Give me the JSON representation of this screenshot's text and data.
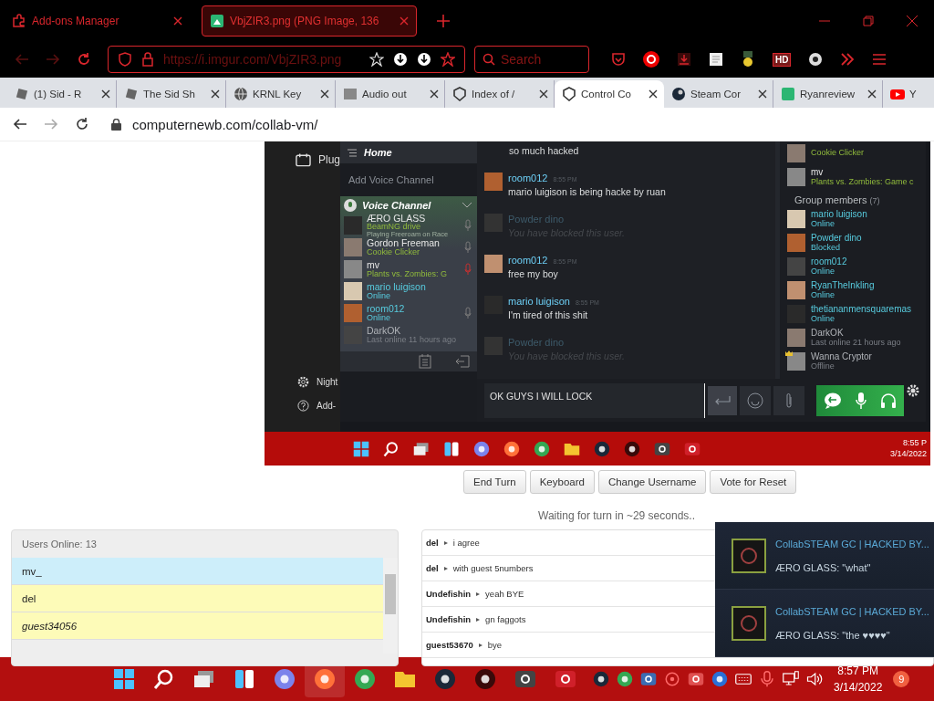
{
  "firefox": {
    "tabs": [
      {
        "title": "Add-ons Manager",
        "selected": false
      },
      {
        "title": "VbjZIR3.png (PNG Image, 136",
        "selected": true
      }
    ],
    "url": "https://i.imgur.com/VbjZIR3.png",
    "search": {
      "placeholder": "Search"
    },
    "hd_label": "HD"
  },
  "chrome": {
    "tabs": [
      {
        "title": "(1) Sid - R",
        "selected": false
      },
      {
        "title": "The Sid Sh",
        "selected": false
      },
      {
        "title": "KRNL Key",
        "selected": false
      },
      {
        "title": "Audio out",
        "selected": false
      },
      {
        "title": "Index of /",
        "selected": false
      },
      {
        "title": "Control Co",
        "selected": true
      },
      {
        "title": "Steam Cor",
        "selected": false
      },
      {
        "title": "Ryanreview",
        "selected": false
      },
      {
        "title": "Y",
        "selected": false
      }
    ],
    "url": "computernewb.com/collab-vm/"
  },
  "vm_screen": {
    "side_menu": [
      "Plug",
      "Night",
      "Add-"
    ],
    "friends": {
      "home": "Home",
      "add_voice": "Add Voice Channel",
      "voice_channel": "Voice Channel",
      "members": [
        {
          "name": "ÆRO GLASS",
          "status": "BeamNG drive",
          "detail": "Playing Freeroam on Race",
          "kind": "in_game",
          "mic": true,
          "muted": false
        },
        {
          "name": "Gordon Freeman",
          "status": "Cookie Clicker",
          "kind": "in_game",
          "mic": true,
          "muted": false
        },
        {
          "name": "mv",
          "status": "Plants vs. Zombies: G",
          "kind": "in_game",
          "mic": true,
          "muted": true
        },
        {
          "name": "mario luigison",
          "status": "Online",
          "kind": "online",
          "mic": false
        },
        {
          "name": "room012",
          "status": "Online",
          "kind": "online",
          "mic": true,
          "muted": false
        },
        {
          "name": "DarkOK",
          "status": "Last online 11 hours ago",
          "kind": "offline",
          "mic": false
        }
      ]
    },
    "messages": [
      {
        "text": "so much hacked",
        "blocked": false
      },
      {
        "author": "room012",
        "time": "8:55 PM",
        "text": "mario luigison is being hacke by ruan",
        "blocked": false
      },
      {
        "author": "Powder dino",
        "text": "You have blocked this user.",
        "blocked": true
      },
      {
        "author": "room012",
        "time": "8:55 PM",
        "text": "free my boy",
        "blocked": false
      },
      {
        "author": "mario luigison",
        "time": "8:55 PM",
        "text": "I'm tired of this shit",
        "blocked": false
      },
      {
        "author": "Powder dino",
        "text": "You have blocked this user.",
        "blocked": true
      }
    ],
    "in_game": [
      {
        "status": "Cookie Clicker"
      },
      {
        "name": "mv",
        "status": "Plants vs. Zombies: Game c"
      }
    ],
    "group_label": "Group members",
    "group_count": "(7)",
    "group": [
      {
        "name": "mario luigison",
        "status": "Online",
        "kind": "online",
        "owner": false
      },
      {
        "name": "Powder dino",
        "status": "Blocked",
        "kind": "online",
        "owner": false
      },
      {
        "name": "room012",
        "status": "Online",
        "kind": "online",
        "owner": false
      },
      {
        "name": "RyanTheInkling",
        "status": "Online",
        "kind": "online",
        "owner": false
      },
      {
        "name": "thetiananmensquaremas",
        "status": "Online",
        "kind": "online",
        "owner": false
      },
      {
        "name": "DarkOK",
        "status": "Last online 21 hours ago",
        "kind": "offline",
        "owner": false
      },
      {
        "name": "Wanna Cryptor",
        "status": "Offline",
        "kind": "offline",
        "owner": true
      }
    ],
    "input": "OK GUYS I WILL LOCK",
    "taskbar": {
      "time": "8:55 P",
      "date": "3/14/2022"
    }
  },
  "buttons": [
    "End Turn",
    "Keyboard",
    "Change Username",
    "Vote for Reset"
  ],
  "turn_status": "Waiting for turn in ~29 seconds..",
  "users": {
    "title": "Users Online: 13",
    "list": [
      {
        "name": "mv_",
        "color": "#cdeefa",
        "italic": false
      },
      {
        "name": "del",
        "color": "#fdfbb8",
        "italic": false
      },
      {
        "name": "guest34056",
        "color": "#fdfbb8",
        "italic": true
      }
    ]
  },
  "chat": [
    {
      "user": "del",
      "text": "i agree"
    },
    {
      "user": "del",
      "text": "with guest 5numbers"
    },
    {
      "user": "Undefishin",
      "text": "yeah BYE"
    },
    {
      "user": "Undefishin",
      "text": "gn faggots"
    },
    {
      "user": "guest53670",
      "text": "bye"
    }
  ],
  "notifications": [
    {
      "title": "CollabSTEAM GC | HACKED BY...",
      "text": "ÆRO GLASS: \"what\""
    },
    {
      "title": "CollabSTEAM GC | HACKED BY...",
      "text": "ÆRO GLASS: \"the ♥♥♥♥\""
    }
  ],
  "taskbar": {
    "time": "8:57 PM",
    "date": "3/14/2022",
    "badge": "9"
  }
}
